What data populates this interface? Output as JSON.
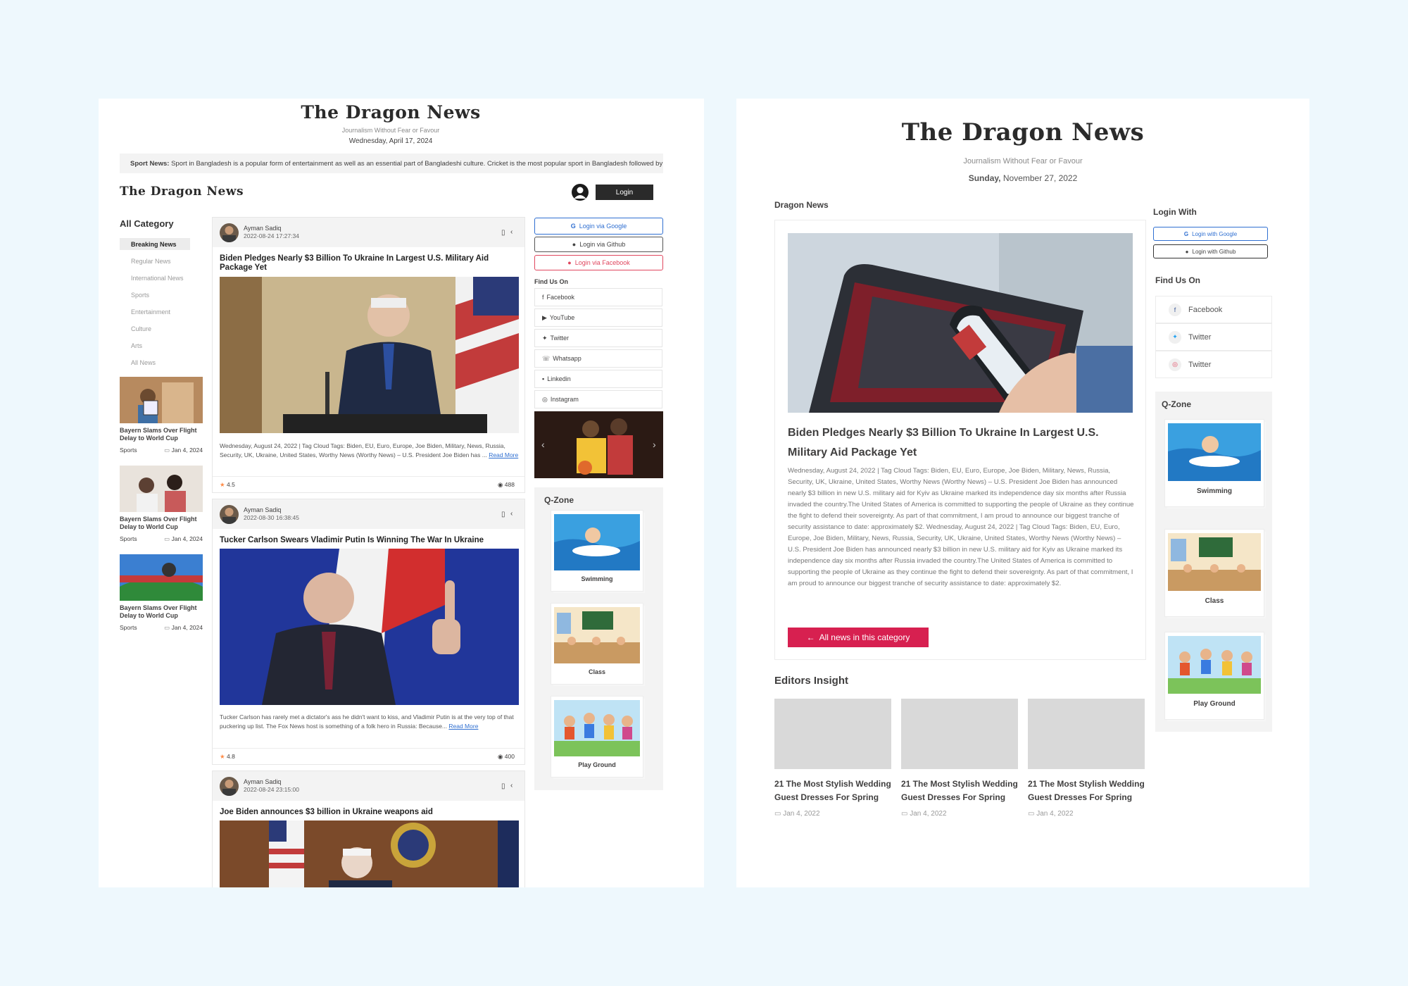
{
  "left": {
    "masthead": "The Dragon News",
    "tagline": "Journalism Without Fear or Favour",
    "date": "Wednesday, April 17, 2024",
    "marquee_label": "Sport News:",
    "marquee_text": "Sport in Bangladesh is a popular form of entertainment as well as an essential part of Bangladeshi culture. Cricket is the most popular sport in Bangladesh followed by",
    "nav_logo": "The Dragon News",
    "login_button": "Login",
    "categories_title": "All Category",
    "categories": [
      "Breaking News",
      "Regular News",
      "International News",
      "Sports",
      "Entertainment",
      "Culture",
      "Arts",
      "All News"
    ],
    "side_news": [
      {
        "title": "Bayern Slams Over Flight Delay to World Cup",
        "tag": "Sports",
        "date": "Jan 4, 2024"
      },
      {
        "title": "Bayern Slams Over Flight Delay to World Cup",
        "tag": "Sports",
        "date": "Jan 4, 2024"
      },
      {
        "title": "Bayern Slams Over Flight Delay to World Cup",
        "tag": "Sports",
        "date": "Jan 4, 2024"
      }
    ],
    "articles": [
      {
        "author": "Ayman Sadiq",
        "datetime": "2022-08-24 17:27:34",
        "title": "Biden Pledges Nearly $3 Billion To Ukraine In Largest U.S. Military Aid Package Yet",
        "excerpt": "Wednesday, August 24, 2022 | Tag Cloud Tags: Biden, EU, Euro, Europe, Joe Biden, Military, News, Russia, Security, UK, Ukraine, United States, Worthy News (Worthy News) – U.S. President Joe Biden has ...",
        "read_more": "Read More",
        "rating": "4.5",
        "views": "488"
      },
      {
        "author": "Ayman Sadiq",
        "datetime": "2022-08-30 16:38:45",
        "title": "Tucker Carlson Swears Vladimir Putin Is Winning The War In Ukraine",
        "excerpt": "Tucker Carlson has rarely met a dictator's ass he didn't want to kiss, and Vladimir Putin is at the very top of that puckering up list. The Fox News host is something of a folk hero in Russia: Because...",
        "read_more": "Read More",
        "rating": "4.8",
        "views": "400"
      },
      {
        "author": "Ayman Sadiq",
        "datetime": "2022-08-24 23:15:00",
        "title": "Joe Biden announces $3 billion in Ukraine weapons aid"
      }
    ],
    "login_google": "Login via Google",
    "login_github": "Login via Github",
    "login_facebook": "Login via Facebook",
    "find_us_title": "Find Us On",
    "find_us": [
      {
        "label": "Facebook",
        "icon": "facebook-icon"
      },
      {
        "label": "YouTube",
        "icon": "youtube-icon"
      },
      {
        "label": "Twitter",
        "icon": "twitter-icon"
      },
      {
        "label": "Whatsapp",
        "icon": "whatsapp-icon"
      },
      {
        "label": "Linkedin",
        "icon": "linkedin-icon"
      },
      {
        "label": "Instagram",
        "icon": "instagram-icon"
      }
    ],
    "qzone_title": "Q-Zone",
    "qzone": [
      "Swimming",
      "Class",
      "Play Ground"
    ]
  },
  "right": {
    "masthead": "The Dragon News",
    "tagline": "Journalism Without Fear or Favour",
    "date_day": "Sunday,",
    "date_rest": "November 27, 2022",
    "section_title": "Dragon News",
    "article_title": "Biden Pledges Nearly $3 Billion To Ukraine In Largest U.S. Military Aid Package Yet",
    "article_body": "Wednesday, August 24, 2022 | Tag Cloud Tags: Biden, EU, Euro, Europe, Joe Biden, Military, News, Russia, Security, UK, Ukraine, United States, Worthy News (Worthy News) – U.S. President Joe Biden has announced nearly $3 billion in new U.S. military aid for Kyiv as Ukraine marked its independence day six months after Russia invaded the country.The United States of America is committed to supporting the people of Ukraine as they continue the fight to defend their sovereignty. As part of that commitment, I am proud to announce our biggest tranche of security assistance to date: approximately $2. Wednesday, August 24, 2022 | Tag Cloud Tags: Biden, EU, Euro, Europe, Joe Biden, Military, News, Russia, Security, UK, Ukraine, United States, Worthy News (Worthy News) – U.S. President Joe Biden has announced nearly $3 billion in new U.S. military aid for Kyiv as Ukraine marked its independence day six months after Russia invaded the country.The United States of America is committed to supporting the people of Ukraine as they continue the fight to defend their sovereignty. As part of that commitment, I am proud to announce our biggest tranche of security assistance to date: approximately $2.",
    "category_button": "All news in this category",
    "editors_title": "Editors Insight",
    "editors": [
      {
        "title": "21 The Most Stylish Wedding Guest Dresses For Spring",
        "date": "Jan 4, 2022"
      },
      {
        "title": "21 The Most Stylish Wedding Guest Dresses For Spring",
        "date": "Jan 4, 2022"
      },
      {
        "title": "21 The Most Stylish Wedding Guest Dresses For Spring",
        "date": "Jan 4, 2022"
      }
    ],
    "login_with_title": "Login With",
    "login_google": "Login with Google",
    "login_github": "Login with Github",
    "find_us_title": "Find Us On",
    "find_us": [
      {
        "label": "Facebook",
        "icon": "facebook-icon"
      },
      {
        "label": "Twitter",
        "icon": "twitter-icon"
      },
      {
        "label": "Twitter",
        "icon": "instagram-icon"
      }
    ],
    "qzone_title": "Q-Zone",
    "qzone": [
      "Swimming",
      "Class",
      "Play Ground"
    ]
  },
  "colors": {
    "background": "#eef8fd",
    "accent_red": "#d72050",
    "google_blue": "#2f6fd1",
    "facebook_red": "#e0465e",
    "dark": "#403f3f",
    "star": "#ff8c47"
  }
}
